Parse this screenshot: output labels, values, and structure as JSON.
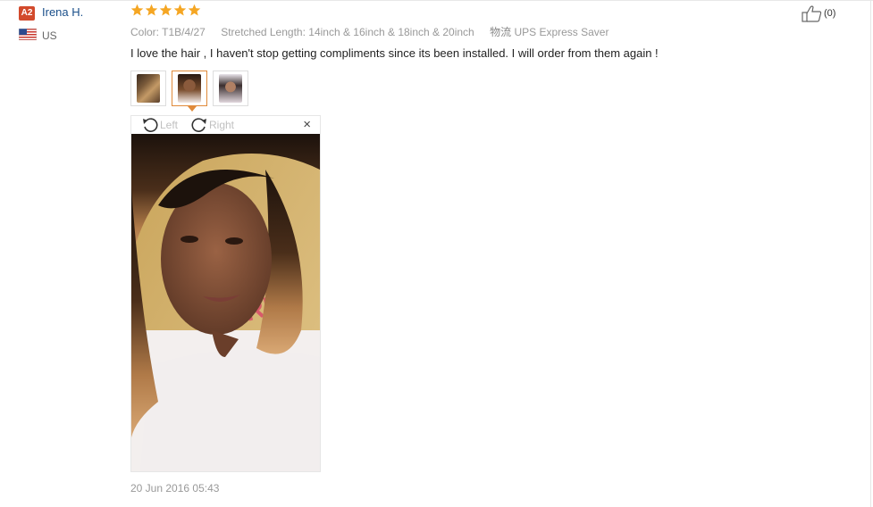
{
  "buyer": {
    "badge": "A2",
    "name": "Irena H.",
    "country": "US",
    "flag_icon": "us-flag-icon"
  },
  "review": {
    "rating": 5,
    "rating_max": 5,
    "star_color": "#f5a623",
    "color_label": "Color:",
    "color_value": "T1B/4/27",
    "length_label": "Stretched Length:",
    "length_value": "14inch & 16inch & 18inch & 20inch",
    "shipping_label": "物流",
    "shipping_value": "UPS Express Saver",
    "text": "I love the hair , I haven't stop getting compliments since its been installed. I will order from them again !",
    "date": "20 Jun 2016 05:43"
  },
  "gallery": {
    "thumbnails": [
      "thumbnail-hair-bundles",
      "thumbnail-selfie-curly",
      "thumbnail-selfie-straight"
    ],
    "active_index": 1,
    "rotate_left_label": "Left",
    "rotate_right_label": "Right",
    "close_symbol": "×"
  },
  "helpful": {
    "icon": "thumbs-up-icon",
    "count": "(0)"
  },
  "colors": {
    "accent": "#e08a3a",
    "badge": "#d24a2c",
    "name_link": "#1a4f8a"
  }
}
